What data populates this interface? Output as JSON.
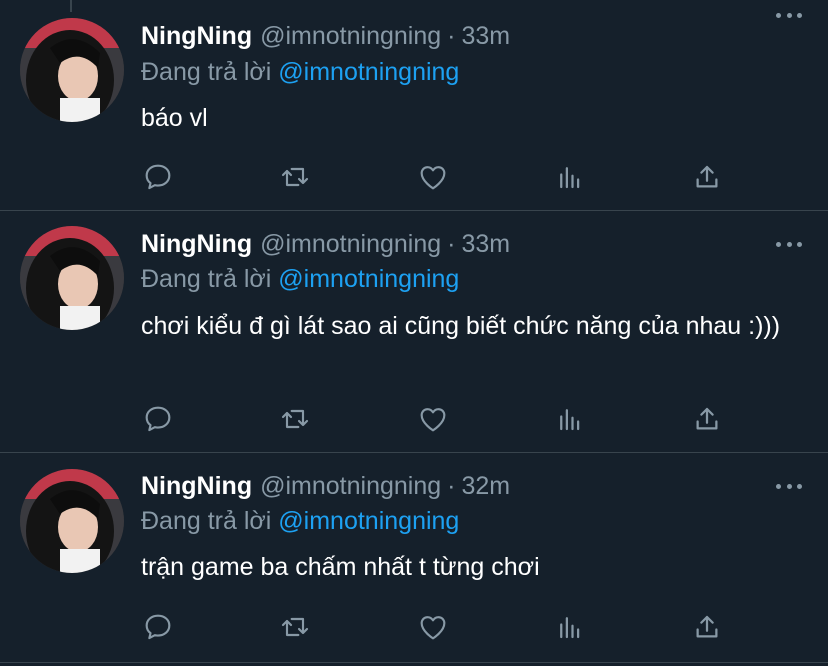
{
  "tweets": [
    {
      "author_name": "NingNing",
      "author_handle": "@imnotningning",
      "separator": "·",
      "time": "33m",
      "reply_prefix": "Đang trả lời",
      "reply_to": "@imnotningning",
      "text": "báo vl"
    },
    {
      "author_name": "NingNing",
      "author_handle": "@imnotningning",
      "separator": "·",
      "time": "33m",
      "reply_prefix": "Đang trả lời",
      "reply_to": "@imnotningning",
      "text": "chơi kiểu đ gì lát sao ai cũng biết chức năng của nhau :)))"
    },
    {
      "author_name": "NingNing",
      "author_handle": "@imnotningning",
      "separator": "·",
      "time": "32m",
      "reply_prefix": "Đang trả lời",
      "reply_to": "@imnotningning",
      "text": "trận game ba chấm nhất t từng chơi"
    }
  ],
  "action_icons": [
    "reply-icon",
    "retweet-icon",
    "like-icon",
    "analytics-icon",
    "share-icon"
  ],
  "colors": {
    "background": "#15202b",
    "divider": "#38444d",
    "secondary_text": "#8899a6",
    "link": "#1da1f2",
    "primary_text": "#ffffff"
  }
}
